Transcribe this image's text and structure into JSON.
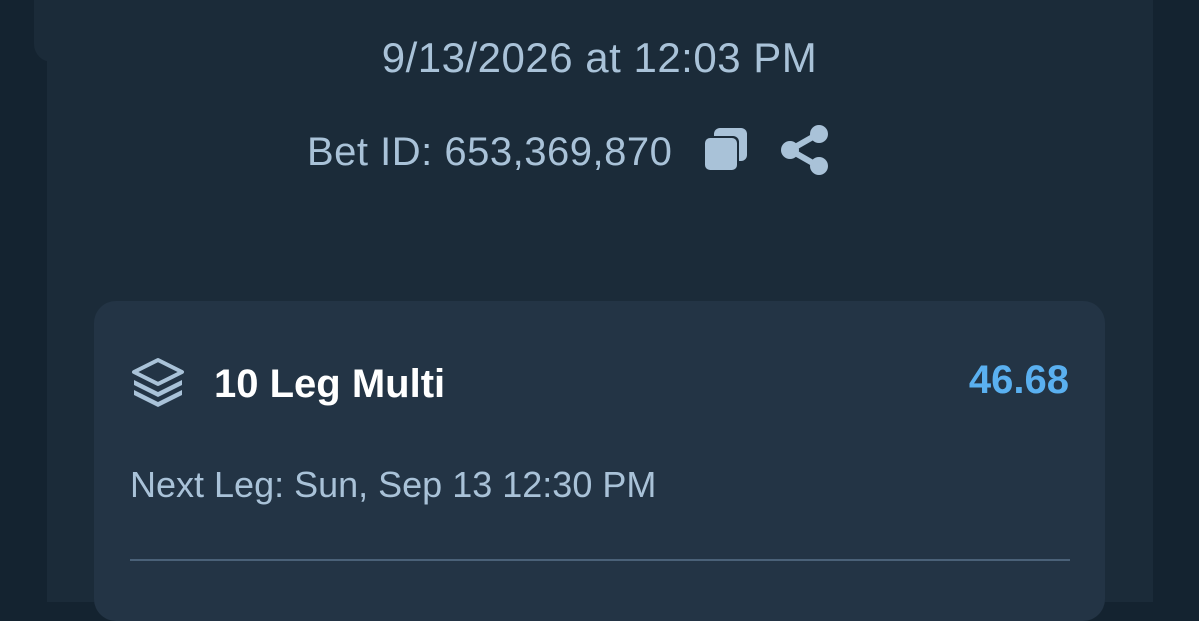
{
  "bet": {
    "timestamp": "9/13/2026 at 12:03 PM",
    "bet_id_label": "Bet ID: 653,369,870"
  },
  "multi": {
    "title": "10 Leg Multi",
    "odds": "46.68",
    "next_leg": "Next Leg: Sun, Sep 13 12:30 PM"
  },
  "colors": {
    "background": "#142330",
    "panel": "#1b2b39",
    "card": "#233445",
    "text_muted": "#a9c2d8",
    "odds_accent": "#5ab0f0"
  },
  "icons": [
    "copy-icon",
    "share-icon",
    "layers-icon"
  ]
}
